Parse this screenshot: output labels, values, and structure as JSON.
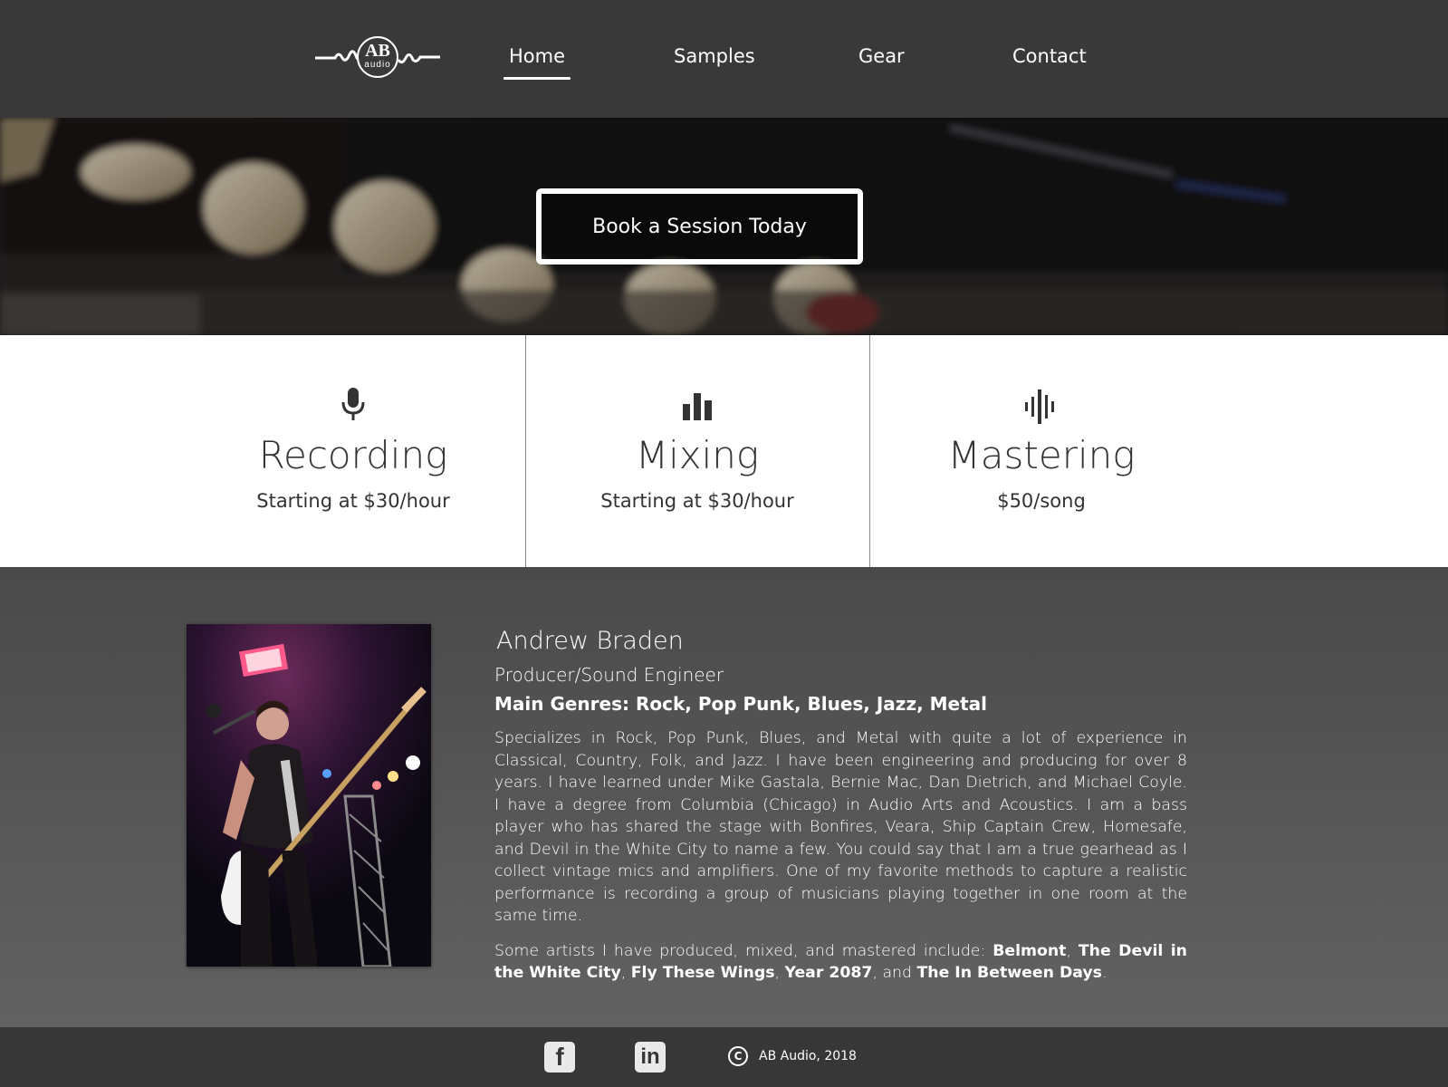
{
  "nav": {
    "logo_text": "AB",
    "logo_sub": "audio",
    "links": [
      {
        "label": "Home",
        "active": true
      },
      {
        "label": "Samples"
      },
      {
        "label": "Gear"
      },
      {
        "label": "Contact"
      }
    ]
  },
  "hero": {
    "cta_label": "Book a Session Today"
  },
  "services": [
    {
      "icon": "microphone-icon",
      "title": "Recording",
      "price": "Starting at $30/hour"
    },
    {
      "icon": "bar-chart-icon",
      "title": "Mixing",
      "price": "Starting at $30/hour"
    },
    {
      "icon": "waveform-icon",
      "title": "Mastering",
      "price": "$50/song"
    }
  ],
  "about": {
    "name": "Andrew Braden",
    "role": "Producer/Sound Engineer",
    "genres": "Main Genres: Rock, Pop Punk, Blues, Jazz, Metal",
    "bio": "Specializes in Rock, Pop Punk, Blues, and Metal with quite a lot of experience in Classical, Country, Folk, and Jazz.  I have been engineering and producing for over 8 years.  I have learned under Mike Gastala, Bernie Mac, Dan Dietrich, and Michael Coyle.  I have a degree from Columbia (Chicago) in Audio Arts and Acoustics.  I am a bass player who has shared the stage with Bonfires, Veara, Ship Captain Crew, Homesafe, and Devil in the White City to name a few.  You could say that I am a true gearhead as I collect vintage mics and amplifiers.  One of my favorite methods to capture a realistic performance is recording a group of musicians playing together in one room at the same time.",
    "artists_intro": "Some artists I have produced, mixed, and mastered include: ",
    "artists": [
      "Belmont",
      "The Devil in the White City",
      "Fly These Wings",
      "Year 2087",
      "The In Between Days"
    ],
    "artists_and": "and"
  },
  "footer": {
    "facebook_label": "f",
    "linkedin_label": "in",
    "copyright_symbol": "C",
    "copyright_text": "AB Audio, 2018"
  }
}
